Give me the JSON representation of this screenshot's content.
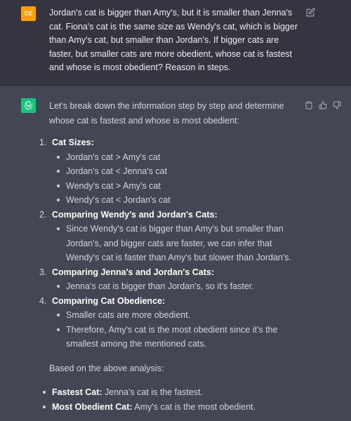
{
  "user": {
    "avatar_initials": "DE",
    "message": "Jordan's cat is bigger than Amy's, but it is smaller than Jenna's cat. Fiona's cat is the same size as Wendy's cat, which is bigger than Amy's cat, but smaller than Jordan's. If bigger cats are faster, but smaller cats are more obedient, whose cat is fastest and whose is most obedient? Reason in steps."
  },
  "assistant": {
    "intro": "Let's break down the information step by step and determine whose cat is fastest and whose is most obedient:",
    "steps": [
      {
        "number": "1.",
        "title": "Cat Sizes:",
        "bullets": [
          "Jordan's cat > Amy's cat",
          "Jordan's cat < Jenna's cat",
          "Wendy's cat > Amy's cat",
          "Wendy's cat < Jordan's cat"
        ]
      },
      {
        "number": "2.",
        "title": "Comparing Wendy's and Jordan's Cats:",
        "bullets": [
          "Since Wendy's cat is bigger than Amy's but smaller than Jordan's, and bigger cats are faster, we can infer that Wendy's cat is faster than Amy's but slower than Jordan's."
        ]
      },
      {
        "number": "3.",
        "title": "Comparing Jenna's and Jordan's Cats:",
        "bullets": [
          "Jenna's cat is bigger than Jordan's, so it's faster."
        ]
      },
      {
        "number": "4.",
        "title": "Comparing Cat Obedience:",
        "bullets": [
          "Smaller cats are more obedient.",
          "Therefore, Amy's cat is the most obedient since it's the smallest among the mentioned cats."
        ]
      }
    ],
    "summary_intro": "Based on the above analysis:",
    "summary": [
      {
        "label": "Fastest Cat:",
        "text": " Jenna's cat is the fastest."
      },
      {
        "label": "Most Obedient Cat:",
        "text": " Amy's cat is the most obedient."
      }
    ]
  },
  "icons": {
    "edit": "edit-icon",
    "copy": "clipboard-icon",
    "like": "thumbs-up-icon",
    "dislike": "thumbs-down-icon",
    "assistant_logo": "openai-logo-icon"
  },
  "colors": {
    "user_bg": "#343541",
    "assistant_bg": "#444654",
    "user_avatar": "#ff9e0b",
    "assistant_avatar": "#19c37d"
  }
}
